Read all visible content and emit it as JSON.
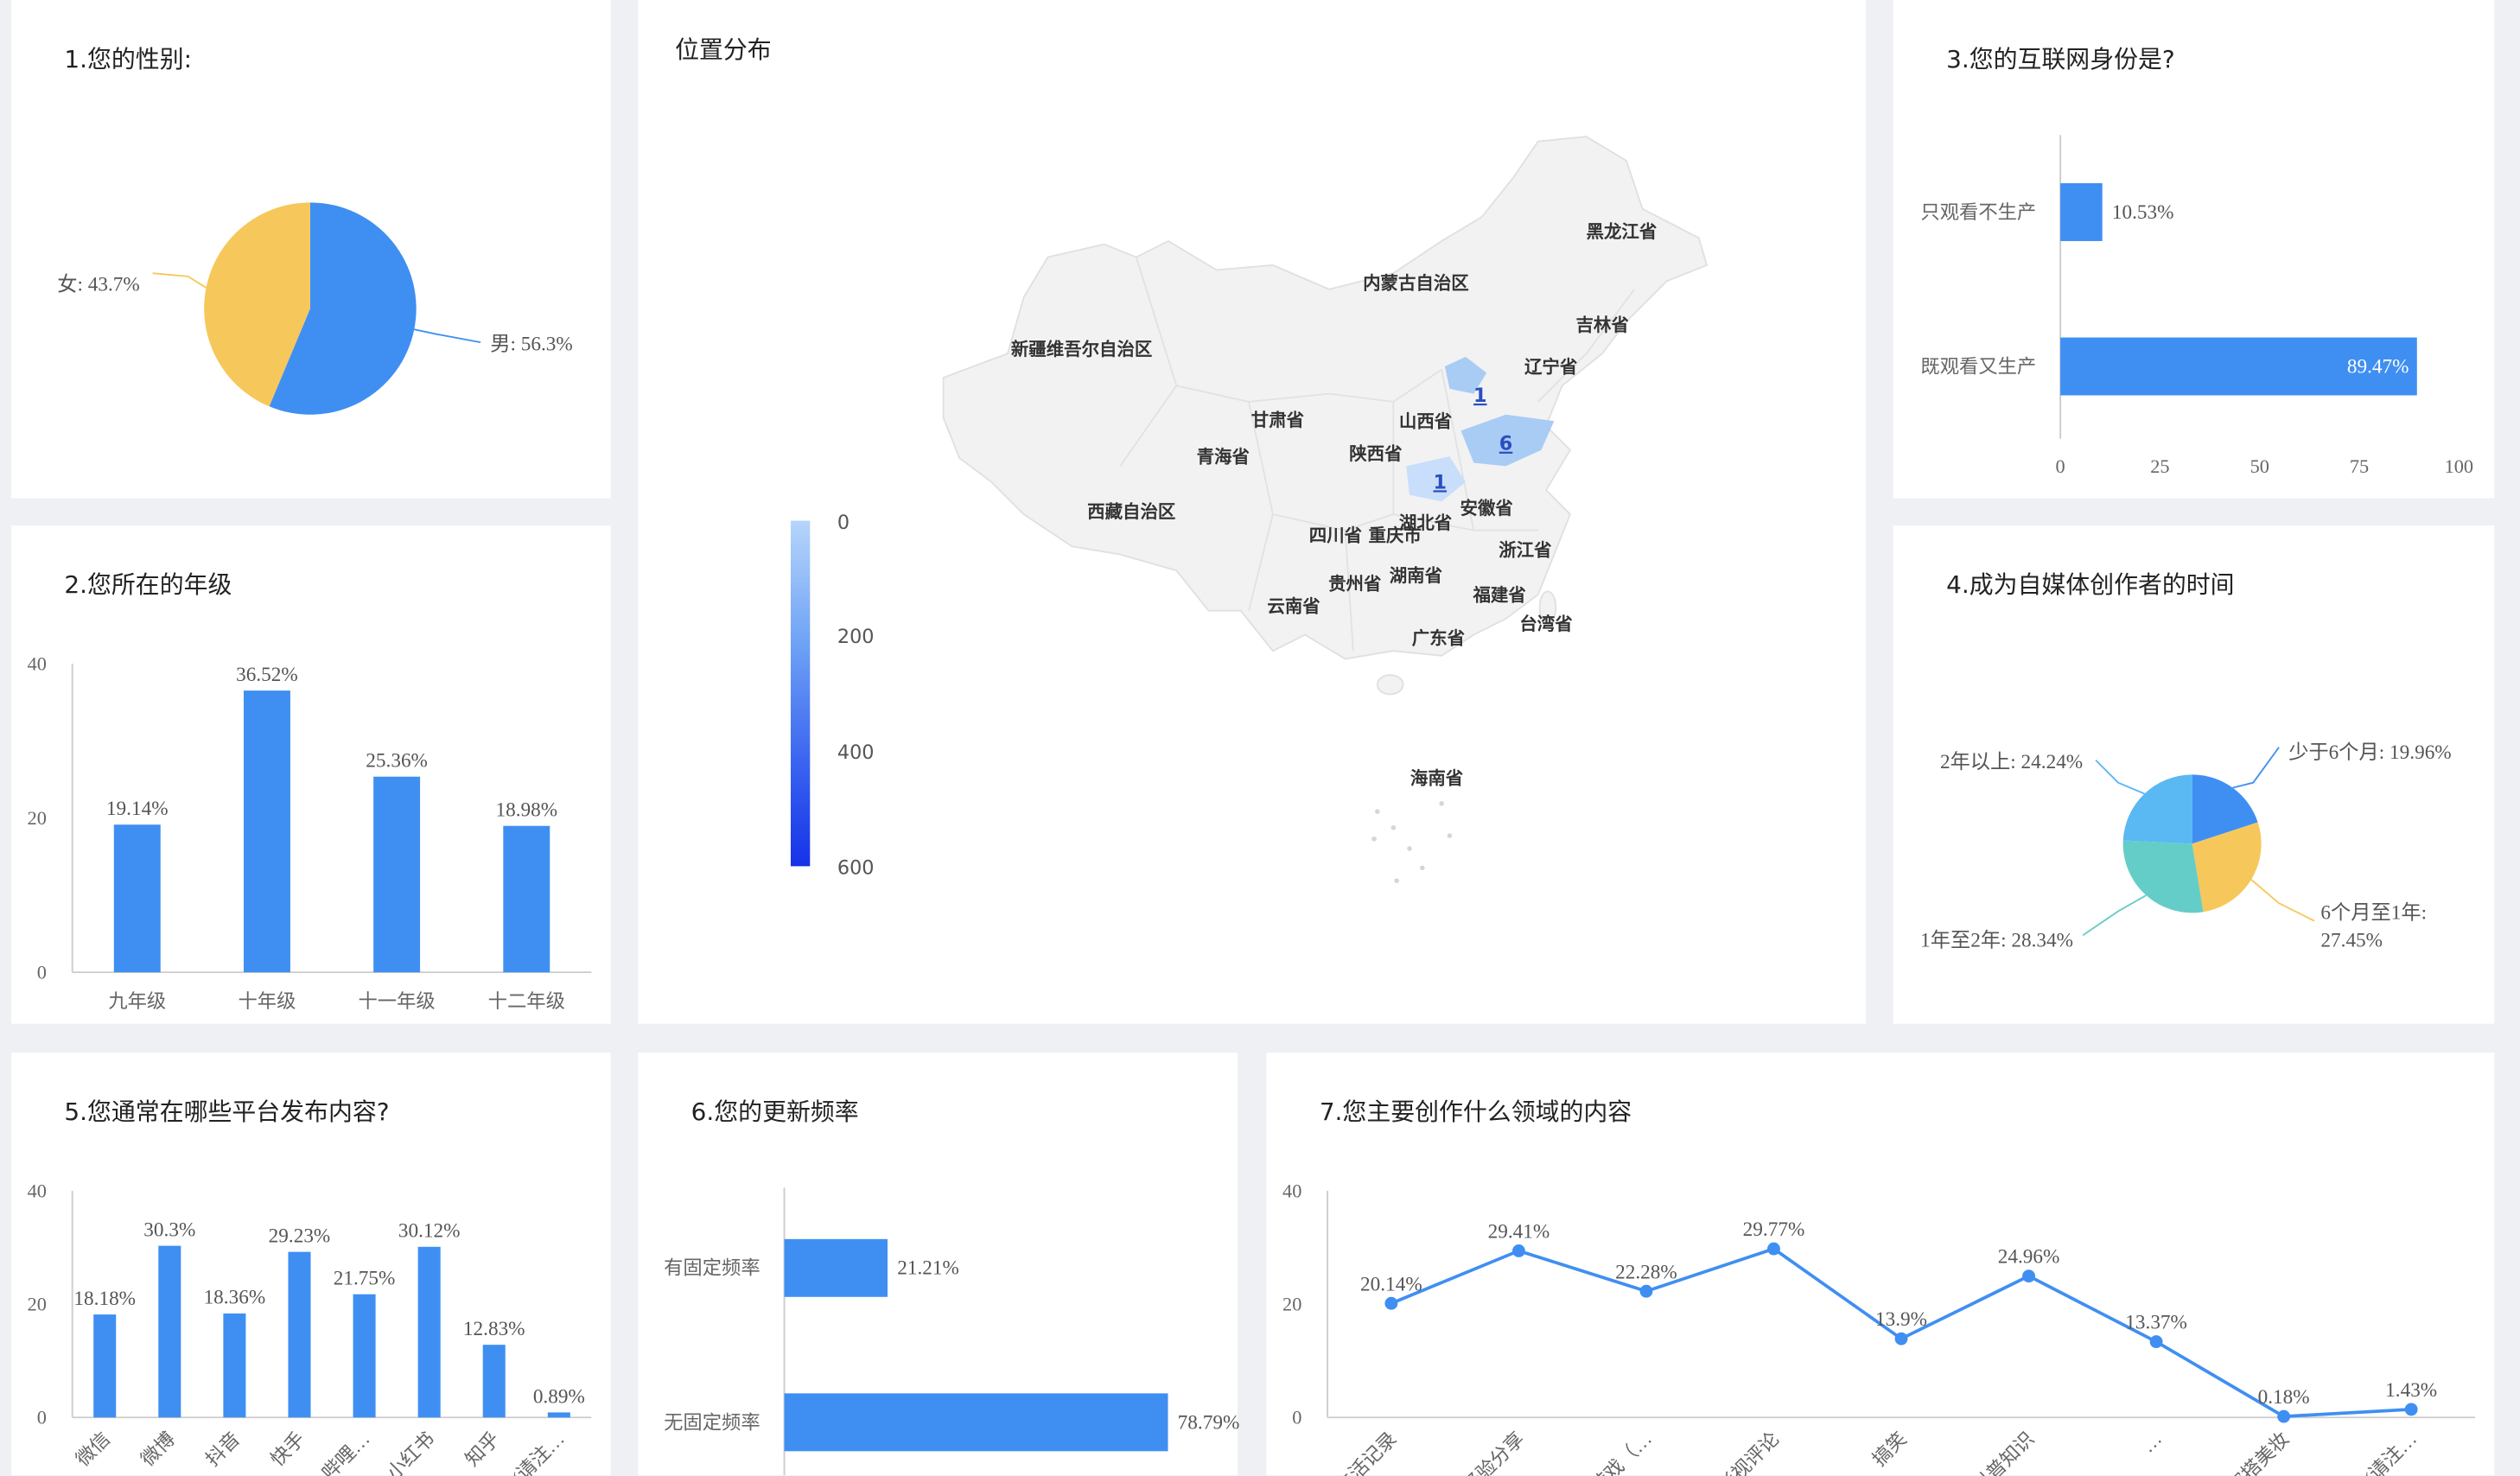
{
  "colors": {
    "primary": "#3f8ff2",
    "pie_yellow": "#f6c75a",
    "pie_cyan": "#65cdc8",
    "pie_lightblue": "#5ab8f3",
    "map_fill": "#f2f2f2",
    "map_highlight": "#a9ccf5"
  },
  "panels": {
    "p1_title": "1.您的性别:",
    "map_title": "位置分布",
    "p3_title": "3.您的互联网身份是?",
    "p2_title": "2.您所在的年级",
    "p4_title": "4.成为自媒体创作者的时间",
    "p5_title": "5.您通常在哪些平台发布内容?",
    "p6_title": "6.您的更新频率",
    "p7_title": "7.您主要创作什么领域的内容"
  },
  "chart_data": [
    {
      "id": "gender",
      "type": "pie",
      "slices": [
        {
          "label": "男: 56.3%",
          "value": 56.3,
          "color": "#3f8ff2"
        },
        {
          "label": "女: 43.7%",
          "value": 43.7,
          "color": "#f6c75a"
        }
      ]
    },
    {
      "id": "map",
      "type": "map",
      "legend_ticks": [
        "0",
        "200",
        "400",
        "600"
      ],
      "provinces": [
        "黑龙江省",
        "内蒙古自治区",
        "吉林省",
        "新疆维吾尔自治区",
        "辽宁省",
        "甘肃省",
        "山西省",
        "青海省",
        "陕西省",
        "西藏自治区",
        "安徽省",
        "四川省",
        "重庆市",
        "湖北省",
        "浙江省",
        "贵州省",
        "湖南省",
        "云南省",
        "福建省",
        "台湾省",
        "广东省",
        "海南省"
      ],
      "markers": [
        "1",
        "6",
        "1"
      ]
    },
    {
      "id": "identity",
      "type": "bar",
      "orientation": "horizontal",
      "categories": [
        "只观看不生产",
        "既观看又生产"
      ],
      "values": [
        10.53,
        89.47
      ],
      "value_labels": [
        "10.53%",
        "89.47%"
      ],
      "xlim": [
        0,
        100
      ],
      "x_ticks": [
        "0",
        "25",
        "50",
        "75",
        "100"
      ]
    },
    {
      "id": "grade",
      "type": "bar",
      "categories": [
        "九年级",
        "十年级",
        "十一年级",
        "十二年级"
      ],
      "values": [
        19.14,
        36.52,
        25.36,
        18.98
      ],
      "value_labels": [
        "19.14%",
        "36.52%",
        "25.36%",
        "18.98%"
      ],
      "ylim": [
        0,
        40
      ],
      "y_ticks": [
        "0",
        "20",
        "40"
      ]
    },
    {
      "id": "creator_time",
      "type": "pie",
      "slices": [
        {
          "label": "少于6个月: 19.96%",
          "value": 19.96,
          "color": "#3f8ff2"
        },
        {
          "label_lines": [
            "6个月至1年:",
            "27.45%"
          ],
          "value": 27.45,
          "color": "#f6c75a"
        },
        {
          "label": "1年至2年: 28.34%",
          "value": 28.34,
          "color": "#65cdc8"
        },
        {
          "label": "2年以上: 24.24%",
          "value": 24.24,
          "color": "#5ab8f3"
        }
      ]
    },
    {
      "id": "platforms",
      "type": "bar",
      "categories": [
        "微信",
        "微博",
        "抖音",
        "快手",
        "哔哩…",
        "小红书",
        "知乎",
        "其他(请注…"
      ],
      "values": [
        18.18,
        30.3,
        18.36,
        29.23,
        21.75,
        30.12,
        12.83,
        0.89
      ],
      "value_labels": [
        "18.18%",
        "30.3%",
        "18.36%",
        "29.23%",
        "21.75%",
        "30.12%",
        "12.83%",
        "0.89%"
      ],
      "ylim": [
        0,
        40
      ],
      "y_ticks": [
        "0",
        "20",
        "40"
      ]
    },
    {
      "id": "frequency",
      "type": "bar",
      "orientation": "horizontal",
      "categories": [
        "有固定频率",
        "无固定频率"
      ],
      "values": [
        21.21,
        78.79
      ],
      "value_labels": [
        "21.21%",
        "78.79%"
      ]
    },
    {
      "id": "domains",
      "type": "line",
      "categories": [
        "日常生活记录",
        "经验分享",
        "游戏（…",
        "影视评论",
        "搞笑",
        "科普知识",
        "…",
        "穿搭美妆",
        "其他(请注…"
      ],
      "values": [
        20.14,
        29.41,
        22.28,
        29.77,
        13.9,
        24.96,
        13.37,
        0.18,
        1.43
      ],
      "value_labels": [
        "20.14%",
        "29.41%",
        "22.28%",
        "29.77%",
        "13.9%",
        "24.96%",
        "13.37%",
        "0.18%",
        "1.43%"
      ],
      "ylim": [
        0,
        40
      ],
      "y_ticks": [
        "0",
        "20",
        "40"
      ]
    }
  ]
}
